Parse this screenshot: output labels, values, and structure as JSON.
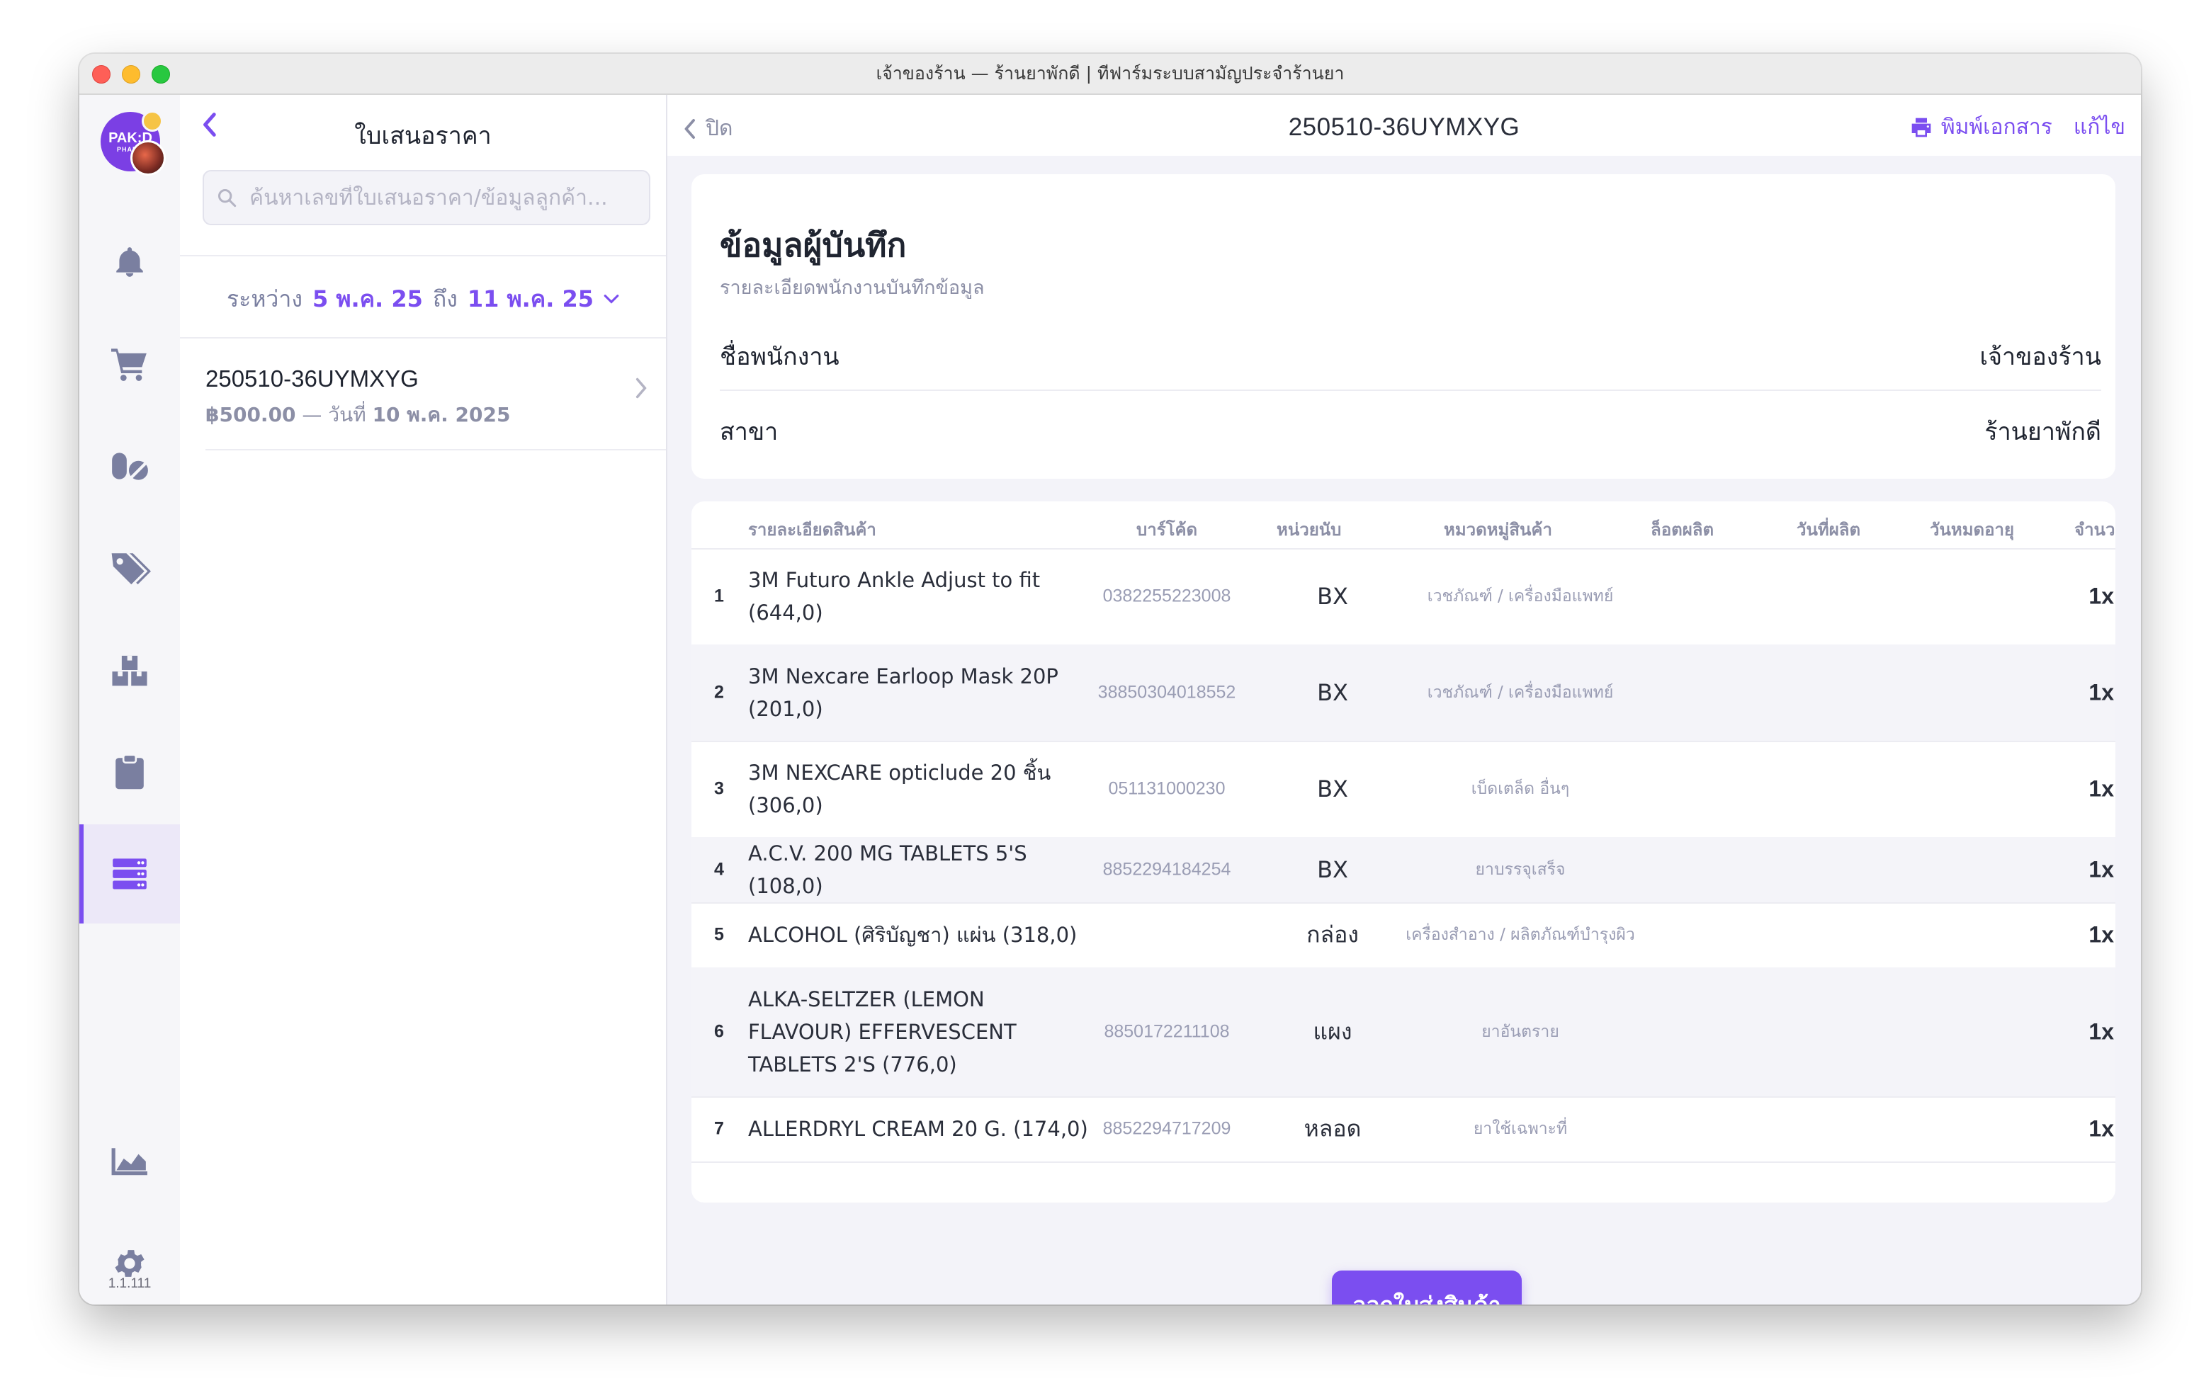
{
  "window": {
    "title": "เจ้าของร้าน — ร้านยาพักดี | ทีฟาร์มระบบสามัญประจำร้านยา"
  },
  "sidebar": {
    "avatar_text": "PAK:D",
    "avatar_sub": "PHARM",
    "items": [
      {
        "icon": "bell-icon"
      },
      {
        "icon": "cart-icon"
      },
      {
        "icon": "pills-icon"
      },
      {
        "icon": "tags-icon"
      },
      {
        "icon": "boxes-icon"
      },
      {
        "icon": "clipboard-icon"
      },
      {
        "icon": "server-stack-icon",
        "active": true
      },
      {
        "icon": "area-chart-icon"
      },
      {
        "icon": "gear-icon"
      }
    ],
    "version": "1.1.111"
  },
  "list": {
    "title": "ใบเสนอราคา",
    "search_placeholder": "ค้นหาเลขที่ใบเสนอราคา/ข้อมูลลูกค้า...",
    "range_label": "ระหว่าง",
    "range_from": "5 พ.ค. 25",
    "range_to_label": "ถึง",
    "range_to": "11 พ.ค. 25",
    "items": [
      {
        "id": "250510-36UYMXYG",
        "amount": "฿500.00",
        "sep": " — ",
        "date_label": "วันที่",
        "date": "10 พ.ค. 2025"
      }
    ]
  },
  "detail": {
    "close_label": "ปิด",
    "doc_id": "250510-36UYMXYG",
    "print_label": "พิมพ์เอกสาร",
    "edit_label": "แก้ไข",
    "recorder": {
      "heading": "ข้อมูลผู้บันทึก",
      "subheading": "รายละเอียดพนักงานบันทึกข้อมูล",
      "employee_label": "ชื่อพนักงาน",
      "employee_value": "เจ้าของร้าน",
      "branch_label": "สาขา",
      "branch_value": "ร้านยาพักดี"
    },
    "table": {
      "headers": [
        "รายละเอียดสินค้า",
        "บาร์โค้ด",
        "หน่วยนับ",
        "หมวดหมู่สินค้า",
        "ล็อตผลิต",
        "วันที่ผลิต",
        "วันหมดอายุ",
        "จำนว"
      ],
      "rows": [
        {
          "num": "1",
          "name": "3M Futuro Ankle Adjust to fit (644,0)",
          "barcode": "0382255223008",
          "unit": "BX",
          "category": "เวชภัณฑ์ / เครื่องมือแพทย์",
          "qty": "1x"
        },
        {
          "num": "2",
          "name": "3M Nexcare Earloop Mask 20P (201,0)",
          "barcode": "38850304018552",
          "unit": "BX",
          "category": "เวชภัณฑ์ / เครื่องมือแพทย์",
          "qty": "1x"
        },
        {
          "num": "3",
          "name": "3M NEXCARE opticlude 20 ชิ้น (306,0)",
          "barcode": "051131000230",
          "unit": "BX",
          "category": "เบ็ดเตล็ด อื่นๆ",
          "qty": "1x"
        },
        {
          "num": "4",
          "name": "A.C.V. 200 MG TABLETS 5'S (108,0)",
          "barcode": "8852294184254",
          "unit": "BX",
          "category": "ยาบรรจุเสร็จ",
          "qty": "1x"
        },
        {
          "num": "5",
          "name": "ALCOHOL (ศิริบัญชา) แผ่น (318,0)",
          "barcode": "",
          "unit": "กล่อง",
          "category": "เครื่องสำอาง / ผลิตภัณฑ์บำรุงผิว",
          "qty": "1x"
        },
        {
          "num": "6",
          "name": "ALKA-SELTZER (LEMON FLAVOUR) EFFERVESCENT TABLETS 2'S (776,0)",
          "barcode": "8850172211108",
          "unit": "แผง",
          "category": "ยาอันตราย",
          "qty": "1x"
        },
        {
          "num": "7",
          "name": "ALLERDRYL CREAM 20 G. (174,0)",
          "barcode": "8852294717209",
          "unit": "หลอด",
          "category": "ยาใช้เฉพาะที่",
          "qty": "1x"
        }
      ]
    },
    "primary_action": "ออกใบส่งสินค้า"
  },
  "colors": {
    "accent": "#7b4ef0",
    "background": "#f3f3f9"
  }
}
